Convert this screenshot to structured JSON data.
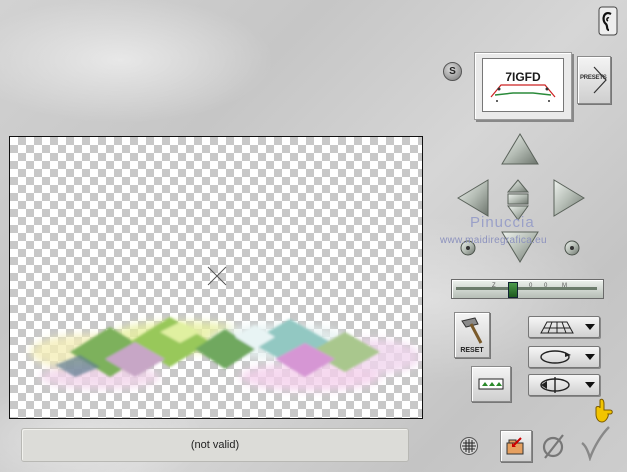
{
  "status_bar": {
    "text": "(not valid)"
  },
  "watermark": {
    "title": "Pinuccia",
    "url": "www.maidiregrafica.eu"
  },
  "side_buttons": {
    "presets_label": "PRESETS",
    "reset_label": "RESET",
    "s_label": "S"
  },
  "zoom_slider": {
    "tick_labels": [
      "Z",
      "0",
      "0",
      "M"
    ],
    "position": 0.4
  },
  "dropdowns": [
    {
      "icon": "perspective-grid-icon"
    },
    {
      "icon": "rotate-ring-icon"
    },
    {
      "icon": "flip-ring-icon"
    }
  ],
  "thumbnail_preview": {
    "logo_text": "7IGFD"
  },
  "colors": {
    "background": "#cccccc",
    "arrow_metal": "#b4bcb4",
    "status_bg": "#dcdcd8",
    "accent_gold": "#e8b800"
  }
}
